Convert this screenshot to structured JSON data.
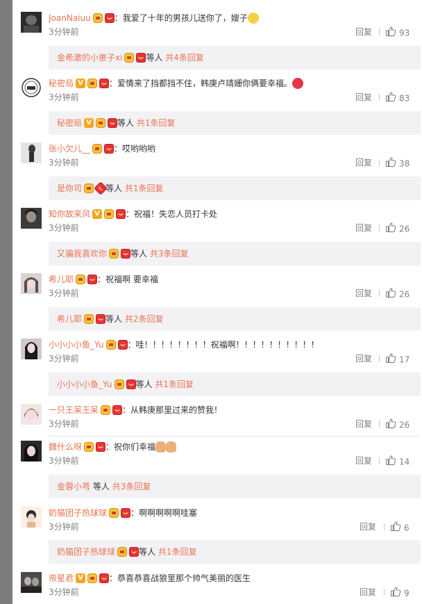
{
  "comments": [
    {
      "user": "JoanNaiuu",
      "text": "：我爱了十年的男孩儿送你了，嫂子",
      "time": "3分钟前",
      "reply_label": "回复",
      "likes": "93",
      "sub": {
        "names": "金希澈的小崽子xi",
        "etc": "等人",
        "total": "共4条回复"
      }
    },
    {
      "user": "秘密局",
      "text": "：爱情来了挡都挡不住，韩庚卢靖姗你俩要幸福。",
      "time": "3分钟前",
      "reply_label": "回复",
      "likes": "83",
      "sub": {
        "names": "秘密局",
        "etc": "等人",
        "total": "共1条回复"
      }
    },
    {
      "user": "张小欠儿__",
      "text": "：哎哟哟哟",
      "time": "3分钟前",
      "reply_label": "回复",
      "likes": "38",
      "sub": {
        "names": "是你司",
        "etc": "等人",
        "total": "共1条回复"
      }
    },
    {
      "user": "知你故来风",
      "text": "：祝福！失恋人员打卡处",
      "time": "3分钟前",
      "reply_label": "回复",
      "likes": "26",
      "sub": {
        "names": "又骗我喜欢你",
        "etc": "等人",
        "total": "共3条回复"
      }
    },
    {
      "user": "希儿耶",
      "text": "：祝福啊 要幸福",
      "time": "3分钟前",
      "reply_label": "回复",
      "likes": "26",
      "sub": {
        "names": "希儿耶",
        "etc": "等人",
        "total": "共2条回复"
      }
    },
    {
      "user": "小小小小鱼_Yu",
      "text": "：哇！！！！！！！！祝福啊！！！！！！！！！！",
      "time": "3分钟前",
      "reply_label": "回复",
      "likes": "17",
      "sub": {
        "names": "小小小小鱼_Yu",
        "etc": "等人",
        "total": "共1条回复"
      }
    },
    {
      "user": "一只王呆王呆",
      "text": "：从韩庚那里过来的赞我！",
      "time": "3分钟前",
      "reply_label": "回复",
      "likes": "26"
    },
    {
      "user": "魏什么呀",
      "text": "：祝你们幸福",
      "time": "3分钟前",
      "reply_label": "回复",
      "likes": "14",
      "sub": {
        "names": "金蓉小芎",
        "etc": "等人",
        "total": "共3条回复"
      }
    },
    {
      "user": "奶猫团子热球球",
      "text": "：啊啊啊啊啊哇塞",
      "time": "3分钟前",
      "reply_label": "回复",
      "likes": "6",
      "sub": {
        "names": "奶猫团子热球球",
        "etc": "等人",
        "total": "共1条回复"
      }
    },
    {
      "user": "帝星君",
      "text": "：恭喜恭喜战狼里那个帅气美丽的医生",
      "time": "3分钟前",
      "reply_label": "回复",
      "likes": "9"
    }
  ],
  "icons": {
    "like": "thumbs-up-icon",
    "verified": "verified-v-icon",
    "member": "member-badge-icon",
    "red_envelope": "red-packet-icon"
  },
  "colors": {
    "username": "#eb7350",
    "meta": "#808080",
    "subbar_bg": "#f2f2f5",
    "page_bg": "#7c7c7c"
  }
}
